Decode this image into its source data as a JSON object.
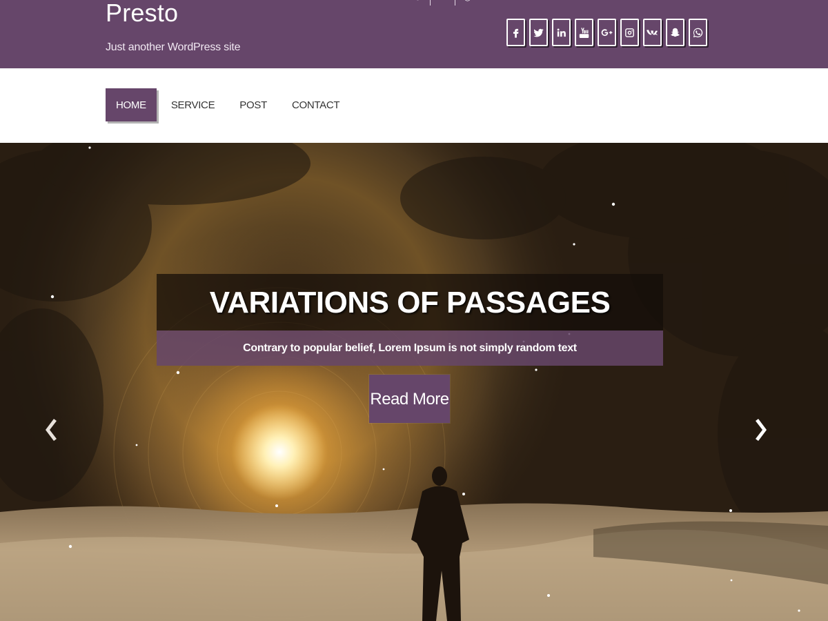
{
  "header": {
    "site_title": "Presto",
    "tagline": "Just another WordPress site"
  },
  "social": [
    {
      "name": "facebook-icon",
      "glyph": "f"
    },
    {
      "name": "twitter-icon",
      "glyph": "t"
    },
    {
      "name": "linkedin-icon",
      "glyph": "in"
    },
    {
      "name": "youtube-icon",
      "glyph": "You Tube"
    },
    {
      "name": "google-plus-icon",
      "glyph": "G+"
    },
    {
      "name": "instagram-icon",
      "glyph": ""
    },
    {
      "name": "vk-icon",
      "glyph": "vk"
    },
    {
      "name": "snapchat-icon",
      "glyph": ""
    },
    {
      "name": "whatsapp-icon",
      "glyph": ""
    }
  ],
  "nav": {
    "items": [
      {
        "label": "HOME",
        "active": true
      },
      {
        "label": "SERVICE",
        "active": false
      },
      {
        "label": "POST",
        "active": false
      },
      {
        "label": "CONTACT",
        "active": false
      }
    ]
  },
  "slider": {
    "title": "VARIATIONS OF PASSAGES",
    "subtitle": "Contrary to popular belief, Lorem Ipsum is not simply random text",
    "button_label": "Read More"
  },
  "colors": {
    "brand": "#66466a",
    "white": "#ffffff"
  }
}
